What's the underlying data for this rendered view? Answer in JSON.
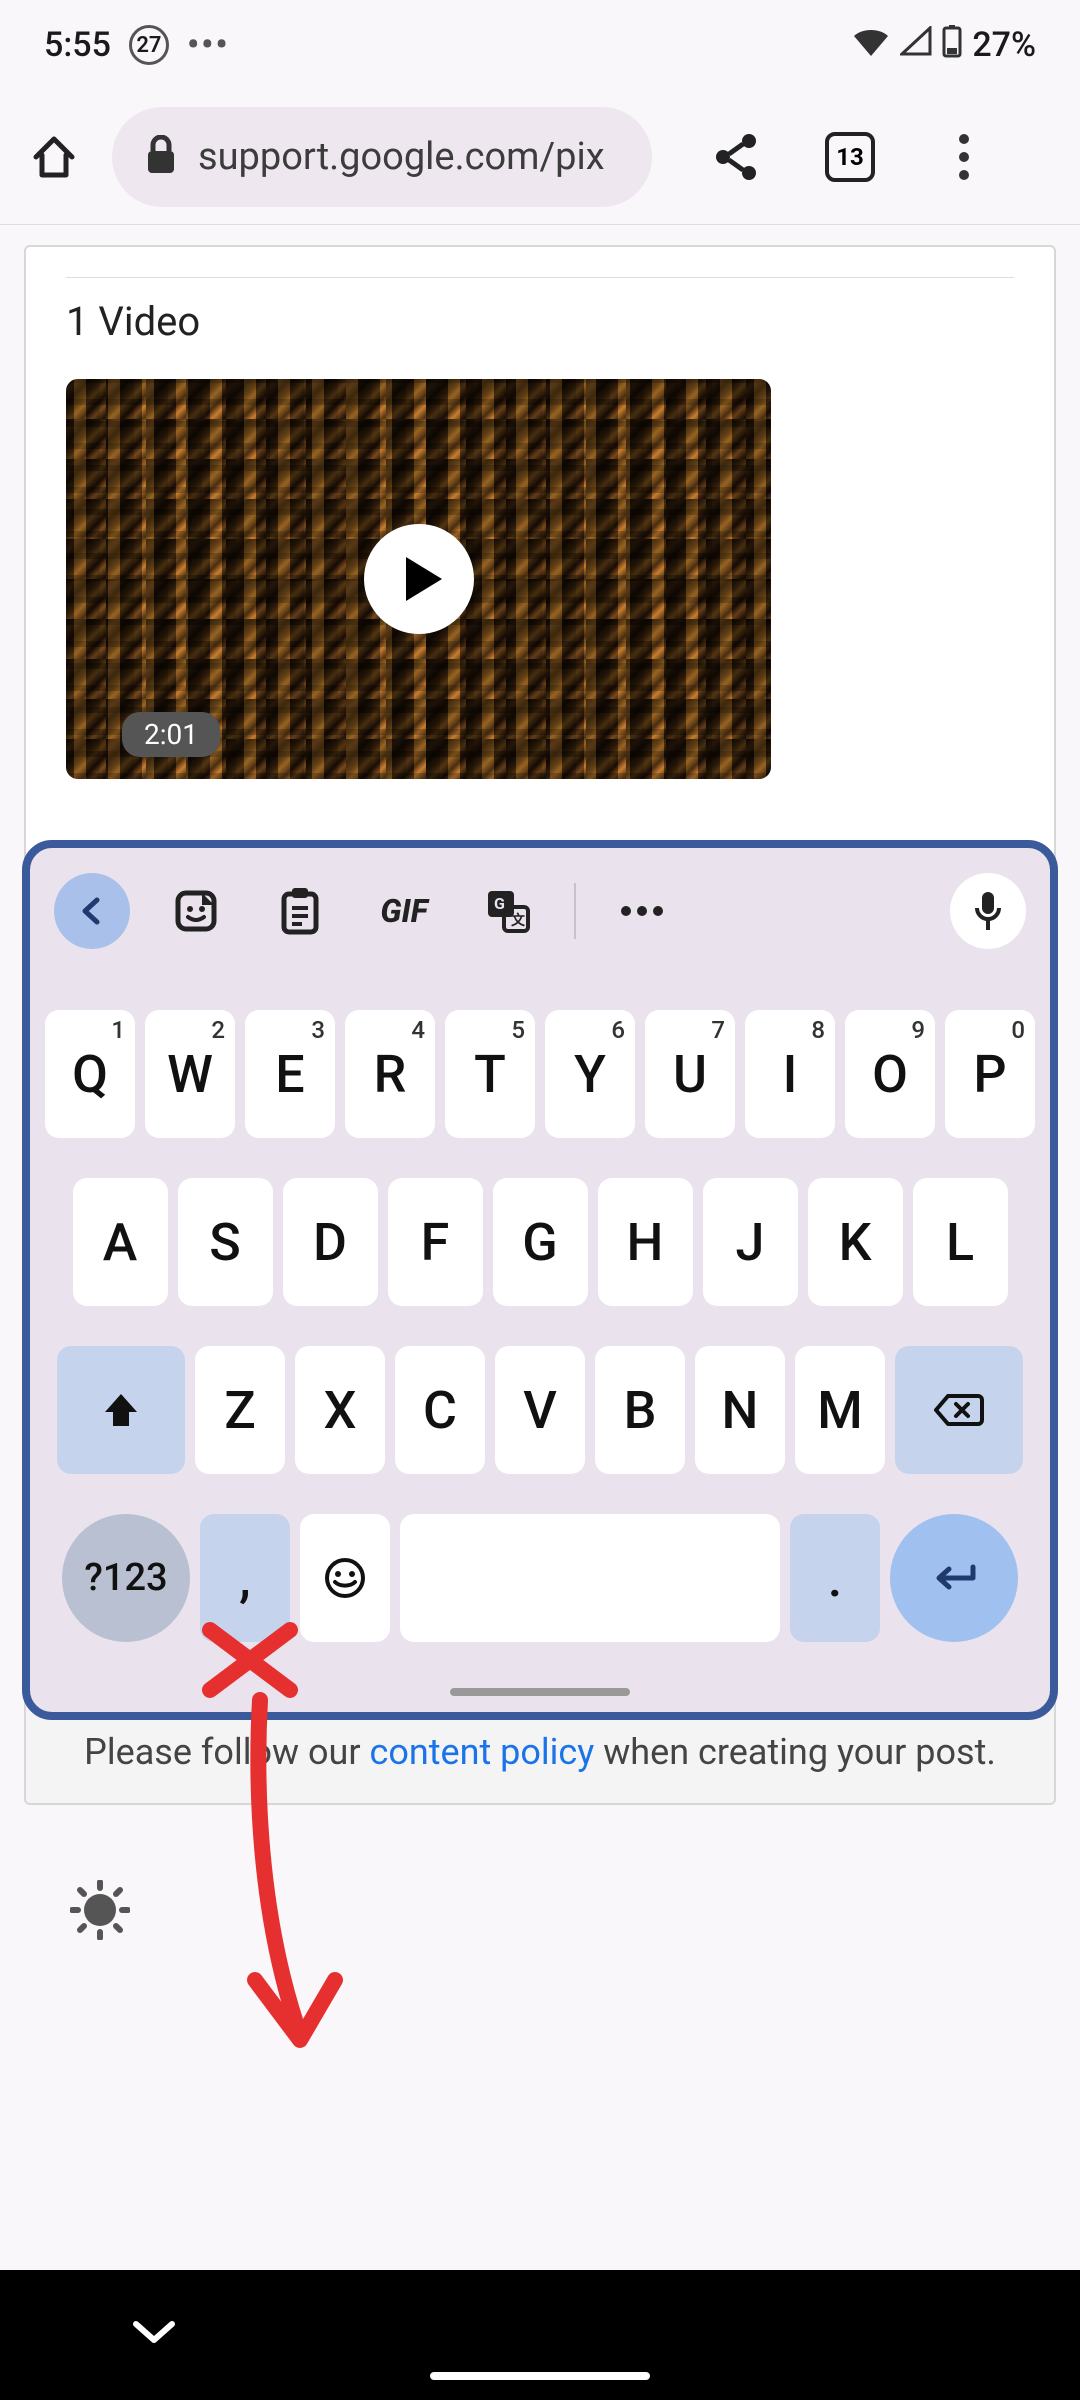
{
  "status": {
    "time": "5:55",
    "badge": "27",
    "battery": "27%"
  },
  "browser": {
    "url": "support.google.com/pix",
    "tab_count": "13"
  },
  "page": {
    "section_title": "1 Video",
    "video_duration": "2:01",
    "policy_prefix": "Please follow our ",
    "policy_link": "content policy",
    "policy_suffix": " when creating your post."
  },
  "keyboard": {
    "tools": {
      "gif": "GIF"
    },
    "row1": [
      {
        "k": "Q",
        "n": "1"
      },
      {
        "k": "W",
        "n": "2"
      },
      {
        "k": "E",
        "n": "3"
      },
      {
        "k": "R",
        "n": "4"
      },
      {
        "k": "T",
        "n": "5"
      },
      {
        "k": "Y",
        "n": "6"
      },
      {
        "k": "U",
        "n": "7"
      },
      {
        "k": "I",
        "n": "8"
      },
      {
        "k": "O",
        "n": "9"
      },
      {
        "k": "P",
        "n": "0"
      }
    ],
    "row2": [
      "A",
      "S",
      "D",
      "F",
      "G",
      "H",
      "J",
      "K",
      "L"
    ],
    "row3": [
      "Z",
      "X",
      "C",
      "V",
      "B",
      "N",
      "M"
    ],
    "numtoggle": "?123",
    "comma": ",",
    "period": "."
  }
}
